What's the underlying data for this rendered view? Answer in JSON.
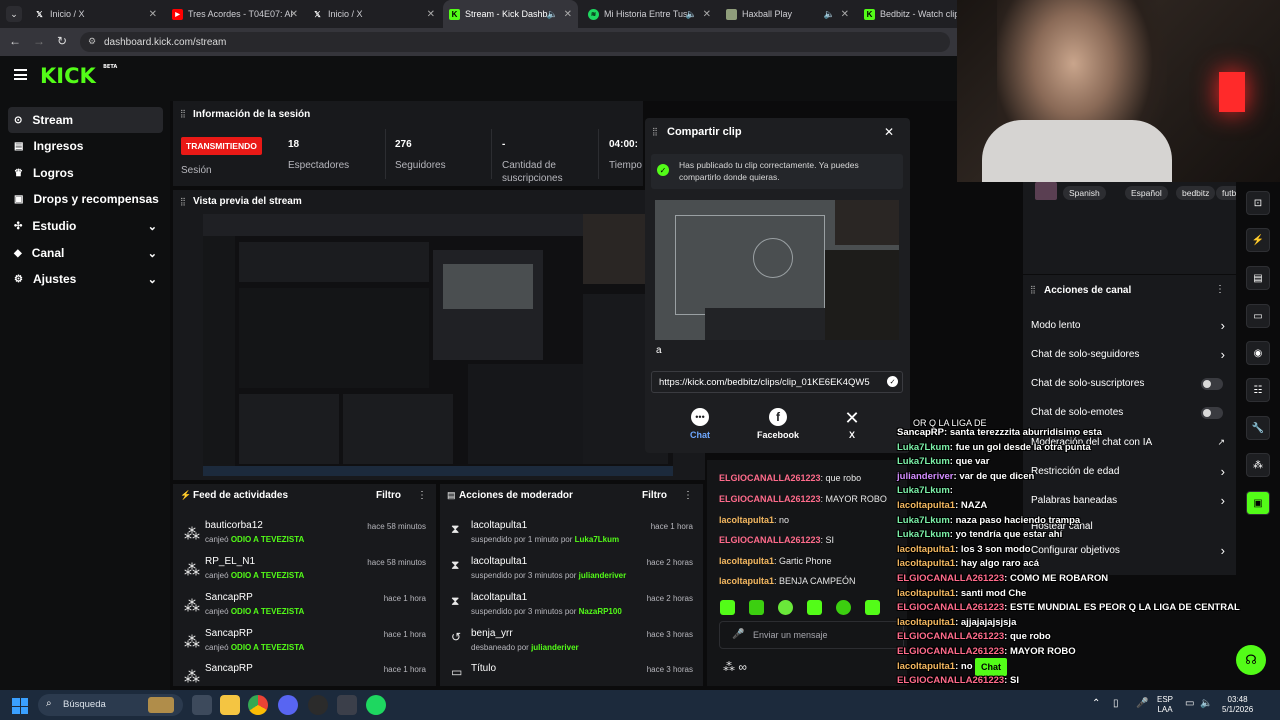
{
  "browser": {
    "tabs": [
      {
        "label": "Inicio / X",
        "icon": "x-icon"
      },
      {
        "label": "Tres Acordes - T04E07: Al",
        "icon": "youtube-icon"
      },
      {
        "label": "Inicio / X",
        "icon": "x-icon"
      },
      {
        "label": "Stream - Kick Dashb",
        "icon": "kick-icon"
      },
      {
        "label": "Mi Historia Entre Tus",
        "icon": "spotify-icon"
      },
      {
        "label": "Haxball Play",
        "icon": "haxball-icon"
      },
      {
        "label": "Bedbitz - Watch clips c",
        "icon": "kick-icon"
      }
    ],
    "url": "dashboard.kick.com/stream"
  },
  "kick": {
    "logo": "KICK",
    "logo_badge": "BETA"
  },
  "sidebar": {
    "items": [
      {
        "label": "Stream",
        "icon": "stream-icon"
      },
      {
        "label": "Ingresos",
        "icon": "revenue-icon"
      },
      {
        "label": "Logros",
        "icon": "trophy-icon"
      },
      {
        "label": "Drops y recompensas",
        "icon": "gift-icon"
      },
      {
        "label": "Estudio",
        "icon": "studio-icon"
      },
      {
        "label": "Canal",
        "icon": "channel-icon"
      },
      {
        "label": "Ajustes",
        "icon": "gear-icon"
      }
    ]
  },
  "session": {
    "title": "Información de la sesión",
    "live_badge": "TRANSMITIENDO",
    "live_label": "Sesión",
    "stats": [
      {
        "value": "18",
        "label": "Espectadores"
      },
      {
        "value": "276",
        "label": "Seguidores"
      },
      {
        "value": "-",
        "label": "Cantidad de suscripciones"
      },
      {
        "value": "04:00:",
        "label": "Tiempo"
      }
    ]
  },
  "preview": {
    "title": "Vista previa del stream"
  },
  "activity": {
    "title": "Feed de actividades",
    "filter": "Filtro",
    "items": [
      {
        "user": "bauticorba12",
        "desc": "canjeó",
        "reward": "ODIO A TEVEZISTA",
        "time": "hace 58 minutos"
      },
      {
        "user": "RP_EL_N1",
        "desc": "canjeó",
        "reward": "ODIO A TEVEZISTA",
        "time": "hace 58 minutos"
      },
      {
        "user": "SancapRP",
        "desc": "canjeó",
        "reward": "ODIO A TEVEZISTA",
        "time": "hace 1 hora"
      },
      {
        "user": "SancapRP",
        "desc": "canjeó",
        "reward": "ODIO A TEVEZISTA",
        "time": "hace 1 hora"
      },
      {
        "user": "SancapRP",
        "desc": "",
        "reward": "",
        "time": "hace 1 hora"
      }
    ]
  },
  "moderator": {
    "title": "Acciones de moderador",
    "filter": "Filtro",
    "items": [
      {
        "user": "lacoltapulta1",
        "desc": "suspendido por 1 minuto por",
        "by": "Luka7Lkum",
        "time": "hace 1 hora",
        "icon": "hourglass-icon"
      },
      {
        "user": "lacoltapulta1",
        "desc": "suspendido por 3 minutos por",
        "by": "julianderiver",
        "time": "hace 2 horas",
        "icon": "hourglass-icon"
      },
      {
        "user": "lacoltapulta1",
        "desc": "suspendido por 3 minutos por",
        "by": "NazaRP100",
        "time": "hace 2 horas",
        "icon": "hourglass-icon"
      },
      {
        "user": "benja_yrr",
        "desc": "desbaneado por",
        "by": "julianderiver",
        "time": "hace 3 horas",
        "icon": "unban-icon"
      },
      {
        "user": "Título",
        "desc": "",
        "by": "",
        "time": "hace 3 horas",
        "icon": "title-icon"
      }
    ]
  },
  "chat": {
    "messages": [
      {
        "user": "ELGIOCANALLA261223",
        "text": "que robo",
        "color": "#ff6b8b"
      },
      {
        "user": "ELGIOCANALLA261223",
        "text": "MAYOR ROBO",
        "color": "#ff6b8b"
      },
      {
        "user": "lacoltapulta1",
        "text": "no",
        "color": "#f4b860"
      },
      {
        "user": "ELGIOCANALLA261223",
        "text": "SI",
        "color": "#ff6b8b"
      },
      {
        "user": "lacoltapulta1",
        "text": "Gartic Phone",
        "color": "#f4b860"
      },
      {
        "user": "lacoltapulta1",
        "text": "BENJA CAMPEÓN",
        "color": "#f4b860"
      }
    ],
    "input_placeholder": "Enviar un mensaje",
    "send_label": "Chat"
  },
  "clip_modal": {
    "title": "Compartir clip",
    "success": "Has publicado tu clip correctamente. Ya puedes compartirlo donde quieras.",
    "caption": "a",
    "link": "https://kick.com/bedbitz/clips/clip_01KE6EK4QW5",
    "share": [
      {
        "label": "Chat",
        "icon": "chat-icon"
      },
      {
        "label": "Facebook",
        "icon": "facebook-icon"
      },
      {
        "label": "X",
        "icon": "x-icon"
      }
    ]
  },
  "stream_tags": [
    "Spanish",
    "Español",
    "bedbitz",
    "futb"
  ],
  "channel_actions": {
    "title": "Acciones de canal",
    "items": [
      {
        "label": "Modo lento",
        "control": "chevron"
      },
      {
        "label": "Chat de solo-seguidores",
        "control": "chevron"
      },
      {
        "label": "Chat de solo-suscriptores",
        "control": "toggle"
      },
      {
        "label": "Chat de solo-emotes",
        "control": "toggle"
      },
      {
        "label": "Moderación del chat con IA",
        "control": "external"
      },
      {
        "label": "Restricción de edad",
        "control": "chevron"
      },
      {
        "label": "Palabras baneadas",
        "control": "chevron"
      },
      {
        "label": "Hostear canal",
        "control": "none"
      },
      {
        "label": "Configurar objetivos",
        "control": "chevron"
      }
    ]
  },
  "overlay_chat": {
    "header": "OR Q LA LIGA DE",
    "lines": [
      {
        "user": "SancapRP",
        "text": "santa terezzzita aburridisimo esta",
        "color": "#ffffff"
      },
      {
        "user": "Luka7Lkum",
        "text": "fue un gol desde la otra punta",
        "color": "#7cf0a8"
      },
      {
        "user": "Luka7Lkum",
        "text": "que var",
        "color": "#7cf0a8"
      },
      {
        "user": "julianderiver",
        "text": "var de que dicen",
        "color": "#d38cff"
      },
      {
        "user": "Luka7Lkum",
        "text": "",
        "color": "#7cf0a8"
      },
      {
        "user": "lacoltapulta1",
        "text": "NAZA",
        "color": "#f4b860"
      },
      {
        "user": "Luka7Lkum",
        "text": "naza paso haciendo trampa",
        "color": "#7cf0a8"
      },
      {
        "user": "Luka7Lkum",
        "text": "yo tendría que estar ahí",
        "color": "#7cf0a8"
      },
      {
        "user": "lacoltapulta1",
        "text": "los 3 son modo",
        "color": "#f4b860"
      },
      {
        "user": "lacoltapulta1",
        "text": "hay algo raro acá",
        "color": "#f4b860"
      },
      {
        "user": "ELGIOCANALLA261223",
        "text": "COMO ME ROBARON",
        "color": "#ff6b8b"
      },
      {
        "user": "lacoltapulta1",
        "text": "santi mod Che",
        "color": "#f4b860"
      },
      {
        "user": "ELGIOCANALLA261223",
        "text": "ESTE MUNDIAL ES PEOR Q LA LIGA DE CENTRAL",
        "color": "#ff6b8b"
      },
      {
        "user": "lacoltapulta1",
        "text": "ajjajajajsjsja",
        "color": "#f4b860"
      },
      {
        "user": "ELGIOCANALLA261223",
        "text": "que robo",
        "color": "#ff6b8b"
      },
      {
        "user": "ELGIOCANALLA261223",
        "text": "MAYOR ROBO",
        "color": "#ff6b8b"
      },
      {
        "user": "lacoltapulta1",
        "text": "no",
        "color": "#f4b860"
      },
      {
        "user": "ELGIOCANALLA261223",
        "text": "SI",
        "color": "#ff6b8b"
      },
      {
        "user": "lacoltapulta1",
        "text": "Gartic Phone",
        "color": "#f4b860"
      },
      {
        "user": "lacoltapulta1",
        "text": "BENJA CAMPEÓN",
        "color": "#f4b860"
      }
    ]
  },
  "taskbar": {
    "search": "Búsqueda",
    "lang_top": "ESP",
    "lang_bottom": "LAA",
    "time": "03:48",
    "date": "5/1/2026"
  },
  "colors": {
    "accent": "#53fc18",
    "live": "#e91916",
    "bg": "#0b0b0c",
    "panel": "#18191c"
  }
}
